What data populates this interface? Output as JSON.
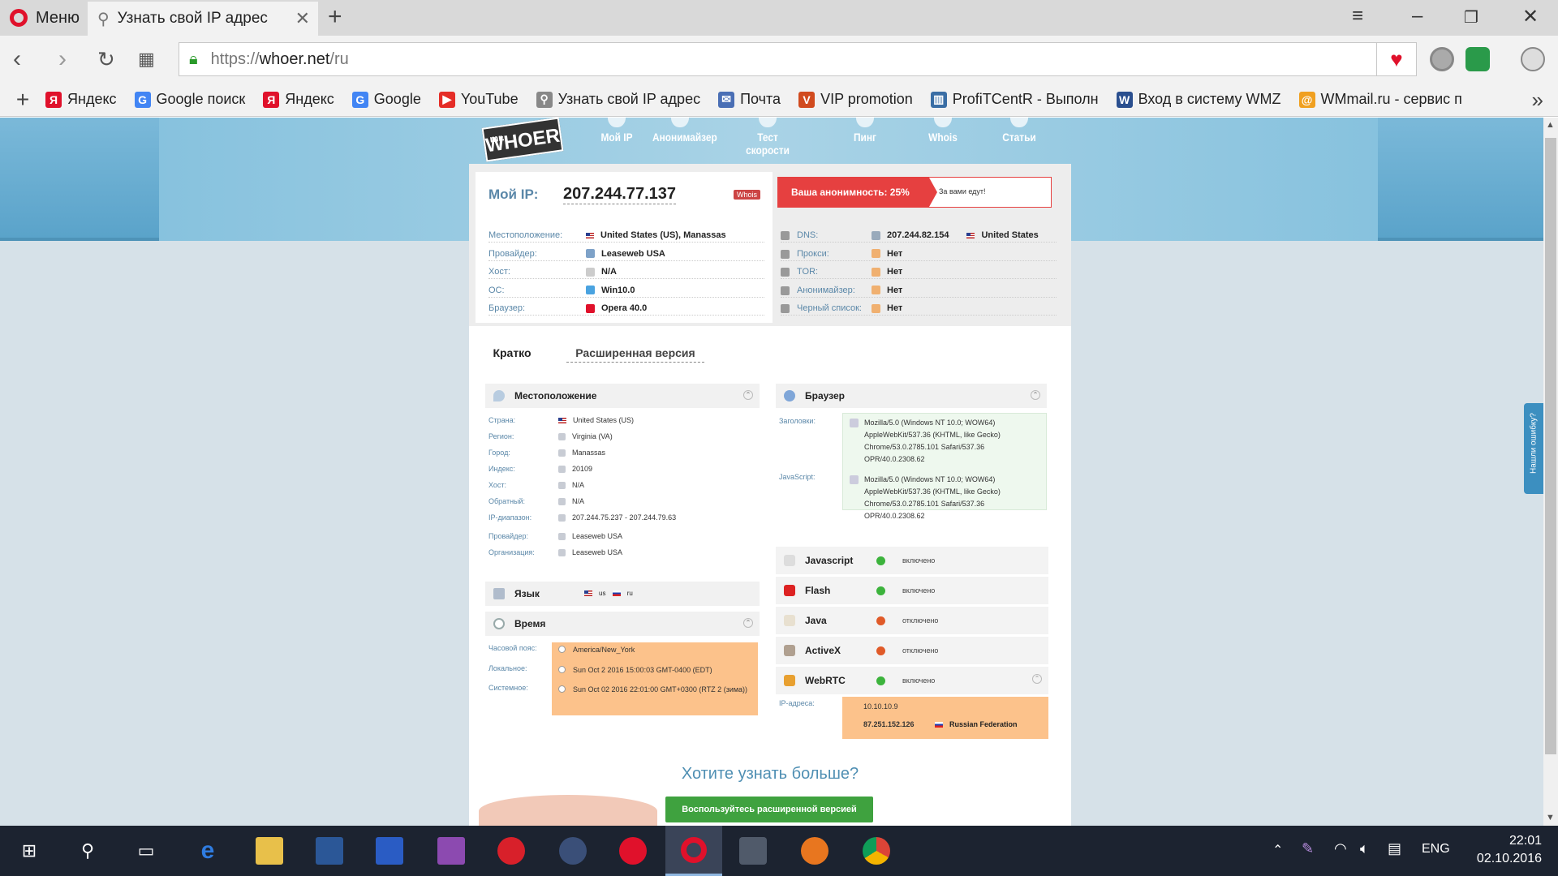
{
  "browser": {
    "menu_label": "Меню",
    "tab_title": "Узнать свой IP адрес",
    "url_prefix": "https://",
    "url_host": "whoer.net",
    "url_path": "/ru",
    "bookmarks": [
      {
        "label": "Яндекс",
        "icon": "yandex-icon",
        "color": "#e0112b",
        "glyph": "Я"
      },
      {
        "label": "Google поиск",
        "icon": "google-icon",
        "color": "#4285f4",
        "glyph": "G"
      },
      {
        "label": "Яндекс",
        "icon": "yandex-icon",
        "color": "#e0112b",
        "glyph": "Я"
      },
      {
        "label": "Google",
        "icon": "google-icon",
        "color": "#4285f4",
        "glyph": "G"
      },
      {
        "label": "YouTube",
        "icon": "youtube-icon",
        "color": "#e52d27",
        "glyph": "▶"
      },
      {
        "label": "Узнать свой IP адрес",
        "icon": "search-icon",
        "color": "#888",
        "glyph": "⚲"
      },
      {
        "label": "Почта",
        "icon": "mail-icon",
        "color": "#4a6fb5",
        "glyph": "✉"
      },
      {
        "label": "VIP promotion",
        "icon": "vip-icon",
        "color": "#d14b1f",
        "glyph": "V"
      },
      {
        "label": "ProfiTCentR - Выполн",
        "icon": "chart-icon",
        "color": "#3a6ea5",
        "glyph": "▥"
      },
      {
        "label": "Вход в систему WMZ",
        "icon": "wmzona-icon",
        "color": "#2a4f8f",
        "glyph": "W"
      },
      {
        "label": "WMmail.ru - сервис п",
        "icon": "wmmail-icon",
        "color": "#f0a020",
        "glyph": "@"
      }
    ]
  },
  "site": {
    "logo_small": "mr.",
    "logo": "WHOER",
    "nav": [
      "Мой IP",
      "Анонимайзер",
      "Тест скорости",
      "Пинг",
      "Whois",
      "Статьи"
    ]
  },
  "ipinfo": {
    "label": "Мой IP:",
    "ip": "207.244.77.137",
    "whois_badge": "Whois",
    "anonymity_label": "Ваша анонимность: 25%",
    "anonymity_note": "За вами едут!",
    "anonymity_color": "#e64040",
    "left_rows": [
      {
        "label": "Местоположение:",
        "value": "United States (US), Manassas",
        "icon": "flag-us"
      },
      {
        "label": "Провайдер:",
        "value": "Leaseweb USA",
        "icon": "provider-icon"
      },
      {
        "label": "Хост:",
        "value": "N/A",
        "icon": "host-icon"
      },
      {
        "label": "ОС:",
        "value": "Win10.0",
        "icon": "windows-icon"
      },
      {
        "label": "Браузер:",
        "value": "Opera 40.0",
        "icon": "opera-icon"
      }
    ],
    "right_rows": [
      {
        "label": "DNS:",
        "value": "207.244.82.154",
        "extra": "United States",
        "icon": "dns-icon"
      },
      {
        "label": "Прокси:",
        "value": "Нет",
        "icon": "proxy-icon"
      },
      {
        "label": "TOR:",
        "value": "Нет",
        "icon": "tor-icon"
      },
      {
        "label": "Анонимайзер:",
        "value": "Нет",
        "icon": "anonymizer-icon"
      },
      {
        "label": "Черный список:",
        "value": "Нет",
        "icon": "blacklist-icon"
      }
    ]
  },
  "tabs": {
    "short": "Кратко",
    "extended": "Расширенная версия"
  },
  "location": {
    "title": "Местоположение",
    "rows": [
      {
        "label": "Страна:",
        "value": "United States (US)"
      },
      {
        "label": "Регион:",
        "value": "Virginia (VA)"
      },
      {
        "label": "Город:",
        "value": "Manassas"
      },
      {
        "label": "Индекс:",
        "value": "20109"
      },
      {
        "label": "Хост:",
        "value": "N/A"
      },
      {
        "label": "Обратный:",
        "value": "N/A"
      },
      {
        "label": "IP-диапазон:",
        "value": "207.244.75.237 - 207.244.79.63"
      },
      {
        "label": "Провайдер:",
        "value": "Leaseweb USA"
      },
      {
        "label": "Организация:",
        "value": "Leaseweb USA"
      }
    ]
  },
  "language": {
    "title": "Язык",
    "values": [
      "us",
      "ru"
    ]
  },
  "time": {
    "title": "Время",
    "rows": [
      {
        "label": "Часовой пояс:",
        "value": "America/New_York"
      },
      {
        "label": "Локальное:",
        "value": "Sun Oct 2 2016 15:00:03 GMT-0400 (EDT)"
      },
      {
        "label": "Системное:",
        "value": "Sun Oct 02 2016 22:01:00 GMT+0300 (RTZ 2 (зима))"
      }
    ]
  },
  "browser_section": {
    "title": "Браузер",
    "headers_label": "Заголовки:",
    "headers_value": "Mozilla/5.0 (Windows NT 10.0; WOW64) AppleWebKit/537.36 (KHTML, like Gecko) Chrome/53.0.2785.101 Safari/537.36 OPR/40.0.2308.62",
    "js_label": "JavaScript:",
    "js_value": "Mozilla/5.0 (Windows NT 10.0; WOW64) AppleWebKit/537.36 (KHTML, like Gecko) Chrome/53.0.2785.101 Safari/537.36 OPR/40.0.2308.62"
  },
  "plugins": [
    {
      "name": "Javascript",
      "status": "включено",
      "on": true,
      "icon": "javascript-icon"
    },
    {
      "name": "Flash",
      "status": "включено",
      "on": true,
      "icon": "flash-icon"
    },
    {
      "name": "Java",
      "status": "отключено",
      "on": false,
      "icon": "java-icon"
    },
    {
      "name": "ActiveX",
      "status": "отключено",
      "on": false,
      "icon": "activex-icon"
    },
    {
      "name": "WebRTC",
      "status": "включено",
      "on": true,
      "icon": "webrtc-icon"
    }
  ],
  "webrtc": {
    "label": "IP-адреса:",
    "ips": [
      "10.10.10.9",
      "87.251.152.126"
    ],
    "country": "Russian Federation"
  },
  "promo": {
    "title": "Хотите узнать больше?",
    "button": "Воспользуйтесь расширенной версией"
  },
  "feedback_tab": "Нашли ошибку?",
  "taskbar": {
    "lang": "ENG",
    "time": "22:01",
    "date": "02.10.2016"
  },
  "colors": {
    "green_on": "#3cb33c",
    "red_off": "#e05a28",
    "accent_blue": "#5a87a8"
  }
}
